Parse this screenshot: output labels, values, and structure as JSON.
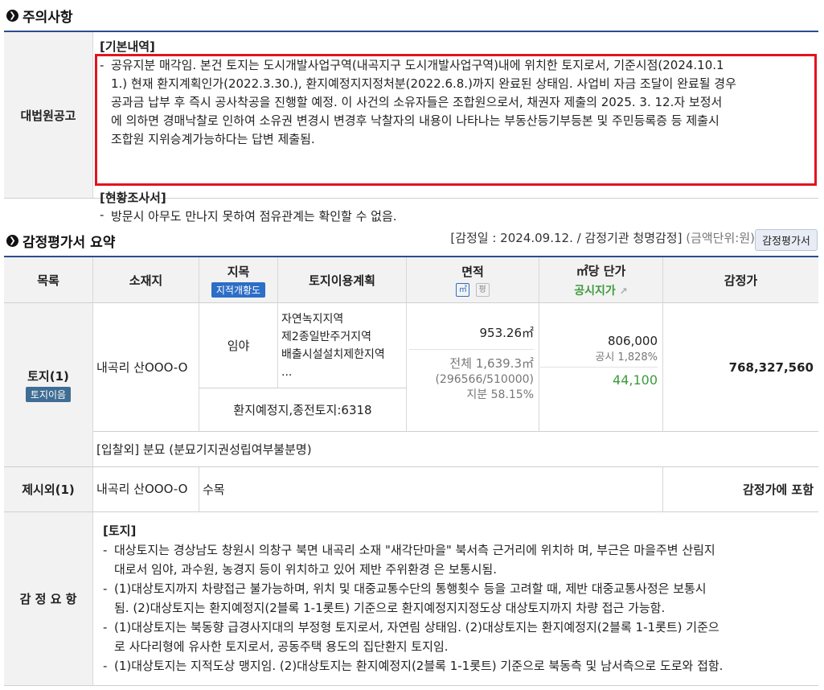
{
  "notice_section": {
    "title": "주의사항",
    "row_header": "대법원공고",
    "basic_heading": "[기본내역]",
    "basic_lines": [
      "공유지분 매각임. 본건 토지는 도시개발사업구역(내곡지구 도시개발사업구역)내에 위치한 토지로서, 기준시점(2024.10.1",
      "1.) 현재 환지계획인가(2022.3.30.), 환지예정지지정처분(2022.6.8.)까지 완료된 상태임. 사업비 자금 조달이 완료될 경우",
      "공과금 납부 후 즉시 공사착공을 진행할 예정. 이 사건의 소유자들은 조합원으로서, 채권자 제출의 2025. 3. 12.자 보정서",
      "에 의하면 경매낙찰로 인하여 소유권 변경시 변경후 낙찰자의 내용이 나타나는 부동산등기부등본 및 주민등록증 등 제출시",
      "조합원 지위승계가능하다는 답변 제출됨."
    ],
    "survey_heading": "[현황조사서]",
    "survey_line": "방문시 아무도 만나지 못하여 점유관계는 확인할 수 없음."
  },
  "appraisal_section": {
    "title": "감정평가서 요약",
    "meta": "[감정일 : 2024.09.12. / 감정기관 청명감정]",
    "unit": "(금액단위:원)",
    "button": "감정평가서",
    "headers": {
      "item": "목록",
      "location": "소재지",
      "jimok": "지목",
      "jimok_badge": "지적개황도",
      "land_plan": "토지이용계획",
      "area": "면적",
      "area_icon_m2": "㎡",
      "area_icon_py": "평",
      "unit_price": "㎡당 단가",
      "public_price": "공시지가",
      "appraised": "감정가"
    },
    "land_row": {
      "item": "토지(1)",
      "item_badge": "토지이음",
      "location": "내곡리 산OOO-O",
      "jimok": "임야",
      "plan_lines": [
        "자연녹지지역",
        "제2종일반주거지역",
        "배출시설설치제한지역",
        "..."
      ],
      "area": "953.26㎡",
      "area_total": "전체 1,639.3㎡",
      "area_ratio": "(296566/510000)",
      "area_share": "지분 58.15%",
      "unit_price": "806,000",
      "public_ratio": "공시 1,828%",
      "public_price": "44,100",
      "appraised": "768,327,560",
      "replot": "환지예정지,종전토지:6318",
      "bid_excluded": "[입찰외] 분묘 (분묘기지권성립여부불분명)"
    },
    "excluded_row": {
      "item": "제시외(1)",
      "location": "내곡리 산OOO-O",
      "desc": "수목",
      "appraised": "감정가에 포함"
    },
    "summary": {
      "header": "감 정 요 항",
      "heading": "[토지]",
      "lines": [
        "대상토지는 경상남도 창원시 의창구 북면 내곡리 소재 \"새각단마을\" 북서측 근거리에 위치하 며, 부근은 마을주변 산림지",
        "대로서 임야, 과수원, 농경지 등이 위치하고 있어 제반 주위환경 은 보통시됨.",
        "(1)대상토지까지 차량접근 불가능하며, 위치 및 대중교통수단의 통행횟수 등을 고려할 때, 제반 대중교통사정은 보통시",
        "됨. (2)대상토지는 환지예정지(2블록 1-1롯트) 기준으로 환지예정지지정도상 대상토지까지 차량 접근 가능함.",
        "(1)대상토지는 북동향 급경사지대의 부정형 토지로서, 자연림 상태임. (2)대상토지는 환지예정지(2블록 1-1롯트) 기준으",
        "로 사다리형에 유사한 토지로서, 공동주택 용도의 집단환지 토지임.",
        "(1)대상토지는 지적도상 맹지임. (2)대상토지는 환지예정지(2블록 1-1롯트) 기준으로 북동측 및 남서측으로 도로와 접함."
      ]
    }
  }
}
